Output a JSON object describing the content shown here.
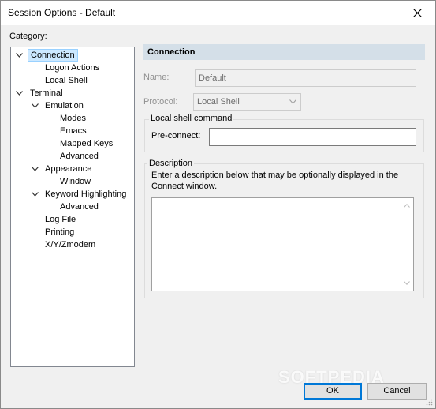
{
  "window": {
    "title": "Session Options - Default"
  },
  "sidebar": {
    "category_label": "Category:",
    "items": [
      {
        "label": "Connection"
      },
      {
        "label": "Logon Actions"
      },
      {
        "label": "Local Shell"
      },
      {
        "label": "Terminal"
      },
      {
        "label": "Emulation"
      },
      {
        "label": "Modes"
      },
      {
        "label": "Emacs"
      },
      {
        "label": "Mapped Keys"
      },
      {
        "label": "Advanced"
      },
      {
        "label": "Appearance"
      },
      {
        "label": "Window"
      },
      {
        "label": "Keyword Highlighting"
      },
      {
        "label": "Advanced"
      },
      {
        "label": "Log File"
      },
      {
        "label": "Printing"
      },
      {
        "label": "X/Y/Zmodem"
      }
    ]
  },
  "main": {
    "section_title": "Connection",
    "name_label": "Name:",
    "name_value": "Default",
    "protocol_label": "Protocol:",
    "protocol_value": "Local Shell",
    "local_shell": {
      "group_title": "Local shell command",
      "preconnect_label": "Pre-connect:",
      "preconnect_value": ""
    },
    "description": {
      "group_title": "Description",
      "help_line1": "Enter a description below that may be optionally displayed in the",
      "help_line2": "Connect window.",
      "value": ""
    }
  },
  "footer": {
    "ok_label": "OK",
    "cancel_label": "Cancel"
  },
  "watermark": "SOFTPEDIA",
  "colors": {
    "accent": "#0078d7",
    "selection": "#cce8ff",
    "header": "#d4dfe8"
  }
}
